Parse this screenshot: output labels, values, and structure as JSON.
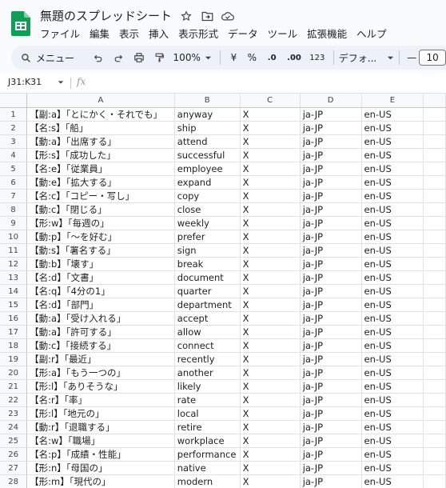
{
  "doc": {
    "title": "無題のスプレッドシート"
  },
  "menu": [
    "ファイル",
    "編集",
    "表示",
    "挿入",
    "表示形式",
    "データ",
    "ツール",
    "拡張機能",
    "ヘルプ"
  ],
  "toolbar": {
    "search": "メニュー",
    "zoom": "100%",
    "currency": "¥",
    "percent": "%",
    "dec_dec": ".0",
    "dec_inc": ".00",
    "number_format": "123",
    "font": "デフォ...",
    "font_size": "10",
    "minus": "—"
  },
  "formula": {
    "namebox": "J31:K31",
    "fx": "fx"
  },
  "columns": [
    "A",
    "B",
    "C",
    "D",
    "E"
  ],
  "rows": [
    {
      "n": "1",
      "a": "【副:a】「とにかく・それでも」",
      "b": "anyway",
      "c": "X",
      "d": "ja-JP",
      "e": "en-US"
    },
    {
      "n": "2",
      "a": "【名:s】「船」",
      "b": "ship",
      "c": "X",
      "d": "ja-JP",
      "e": "en-US"
    },
    {
      "n": "3",
      "a": "【動:a】「出席する」",
      "b": "attend",
      "c": "X",
      "d": "ja-JP",
      "e": "en-US"
    },
    {
      "n": "4",
      "a": "【形:s】「成功した」",
      "b": "successful",
      "c": "X",
      "d": "ja-JP",
      "e": "en-US"
    },
    {
      "n": "5",
      "a": "【名:e】「従業員」",
      "b": "employee",
      "c": "X",
      "d": "ja-JP",
      "e": "en-US"
    },
    {
      "n": "6",
      "a": "【動:e】「拡大する」",
      "b": "expand",
      "c": "X",
      "d": "ja-JP",
      "e": "en-US"
    },
    {
      "n": "7",
      "a": "【名:c】「コピー・写し」",
      "b": "copy",
      "c": "X",
      "d": "ja-JP",
      "e": "en-US"
    },
    {
      "n": "8",
      "a": "【動:c】「閉じる」",
      "b": "close",
      "c": "X",
      "d": "ja-JP",
      "e": "en-US"
    },
    {
      "n": "9",
      "a": "【形:w】「毎週の」",
      "b": "weekly",
      "c": "X",
      "d": "ja-JP",
      "e": "en-US"
    },
    {
      "n": "10",
      "a": "【動:p】「〜を好む」",
      "b": "prefer",
      "c": "X",
      "d": "ja-JP",
      "e": "en-US"
    },
    {
      "n": "11",
      "a": "【動:s】「署名する」",
      "b": "sign",
      "c": "X",
      "d": "ja-JP",
      "e": "en-US"
    },
    {
      "n": "12",
      "a": "【動:b】「壊す」",
      "b": "break",
      "c": "X",
      "d": "ja-JP",
      "e": "en-US"
    },
    {
      "n": "13",
      "a": "【名:d】「文書」",
      "b": "document",
      "c": "X",
      "d": "ja-JP",
      "e": "en-US"
    },
    {
      "n": "14",
      "a": "【名:q】「4分の1」",
      "b": "quarter",
      "c": "X",
      "d": "ja-JP",
      "e": "en-US"
    },
    {
      "n": "15",
      "a": "【名:d】「部門」",
      "b": "department",
      "c": "X",
      "d": "ja-JP",
      "e": "en-US"
    },
    {
      "n": "16",
      "a": "【動:a】「受け入れる」",
      "b": "accept",
      "c": "X",
      "d": "ja-JP",
      "e": "en-US"
    },
    {
      "n": "17",
      "a": "【動:a】「許可する」",
      "b": "allow",
      "c": "X",
      "d": "ja-JP",
      "e": "en-US"
    },
    {
      "n": "18",
      "a": "【動:c】「接続する」",
      "b": "connect",
      "c": "X",
      "d": "ja-JP",
      "e": "en-US"
    },
    {
      "n": "19",
      "a": "【副:r】「最近」",
      "b": "recently",
      "c": "X",
      "d": "ja-JP",
      "e": "en-US"
    },
    {
      "n": "20",
      "a": "【形:a】「もう一つの」",
      "b": "another",
      "c": "X",
      "d": "ja-JP",
      "e": "en-US"
    },
    {
      "n": "21",
      "a": "【形:l】「ありそうな」",
      "b": "likely",
      "c": "X",
      "d": "ja-JP",
      "e": "en-US"
    },
    {
      "n": "22",
      "a": "【名:r】「率」",
      "b": "rate",
      "c": "X",
      "d": "ja-JP",
      "e": "en-US"
    },
    {
      "n": "23",
      "a": "【形:l】「地元の」",
      "b": "local",
      "c": "X",
      "d": "ja-JP",
      "e": "en-US"
    },
    {
      "n": "24",
      "a": "【動:r】「退職する」",
      "b": "retire",
      "c": "X",
      "d": "ja-JP",
      "e": "en-US"
    },
    {
      "n": "25",
      "a": "【名:w】「職場」",
      "b": "workplace",
      "c": "X",
      "d": "ja-JP",
      "e": "en-US"
    },
    {
      "n": "26",
      "a": "【名:p】「成績・性能」",
      "b": "performance",
      "c": "X",
      "d": "ja-JP",
      "e": "en-US"
    },
    {
      "n": "27",
      "a": "【形:n】「母国の」",
      "b": "native",
      "c": "X",
      "d": "ja-JP",
      "e": "en-US"
    },
    {
      "n": "28",
      "a": "【形:m】「現代の」",
      "b": "modern",
      "c": "X",
      "d": "ja-JP",
      "e": "en-US"
    }
  ]
}
